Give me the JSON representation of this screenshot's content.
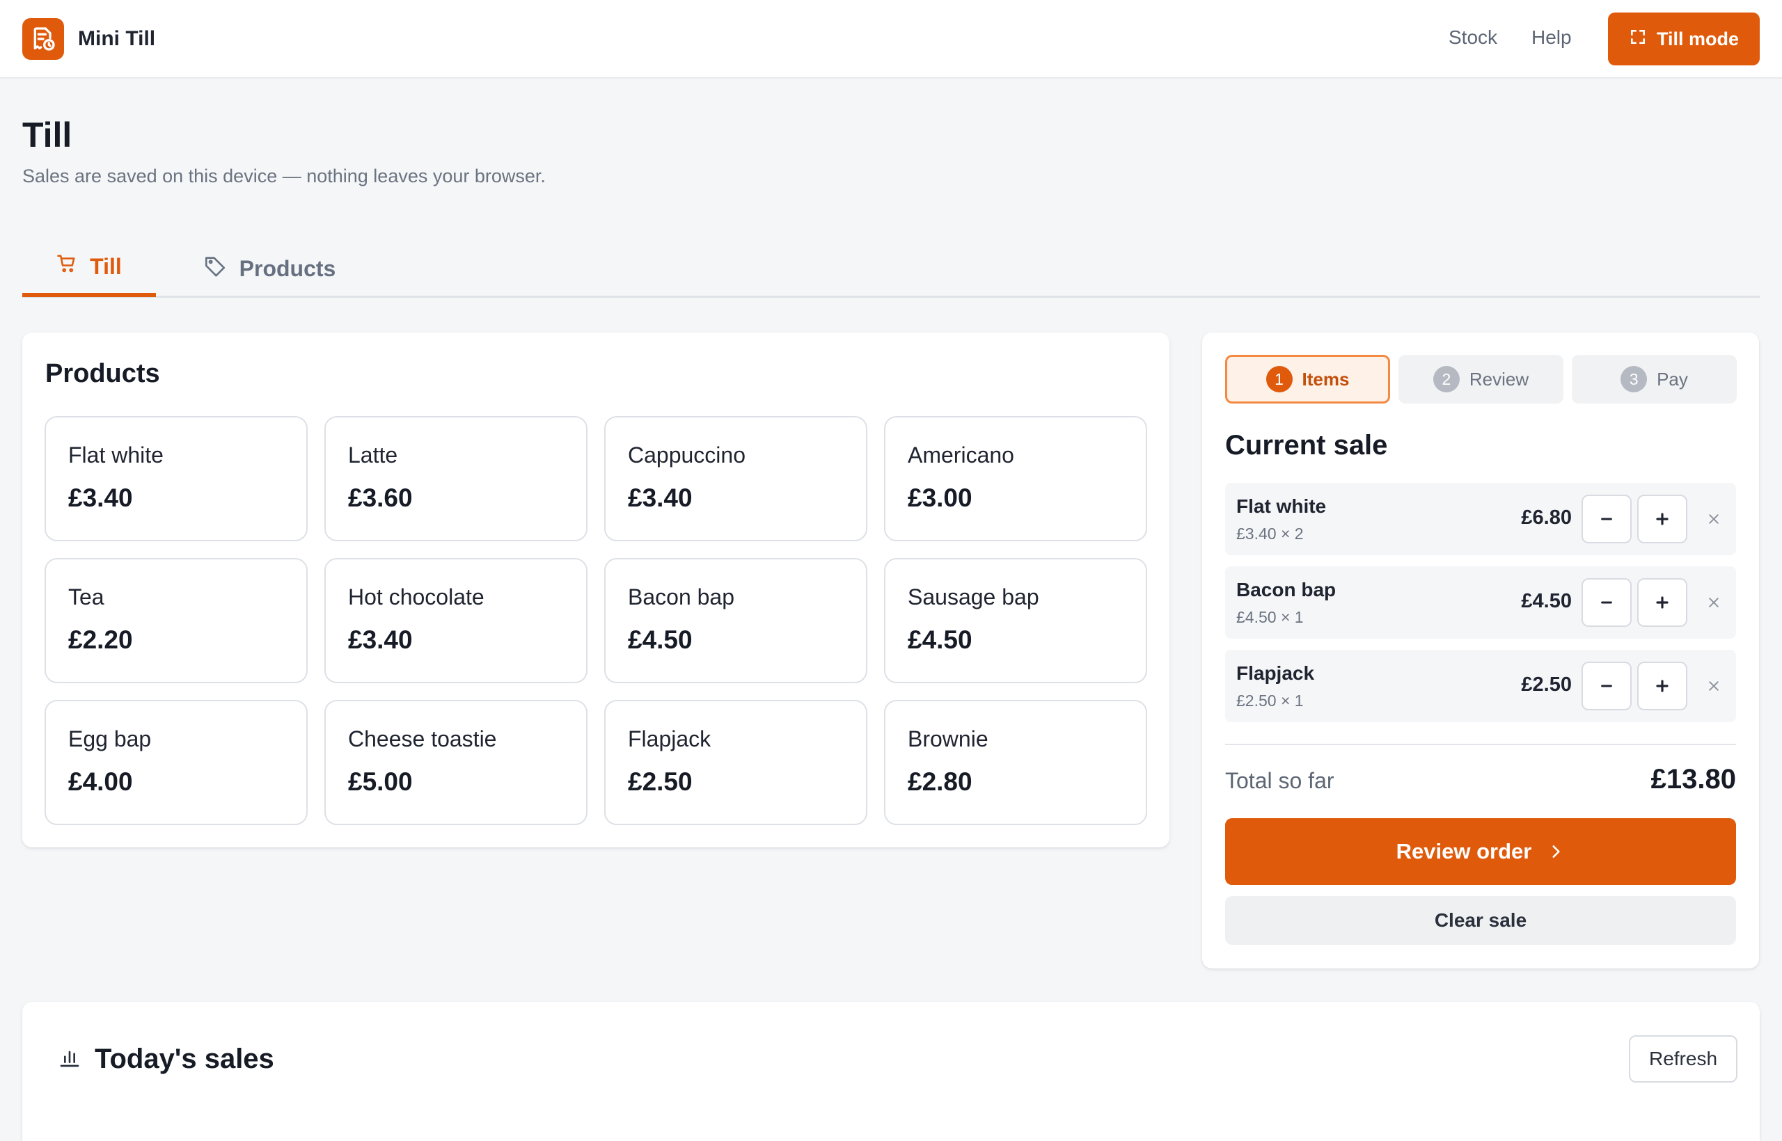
{
  "app": {
    "name": "Mini Till",
    "logo_icon": "receipt-icon",
    "accent_color": "#df5a0b"
  },
  "nav": {
    "links": [
      "Stock",
      "Help"
    ],
    "till_mode_label": "Till mode"
  },
  "page": {
    "title": "Till",
    "subtitle": "Sales are saved on this device — nothing leaves your browser."
  },
  "tabs": [
    {
      "label": "Till",
      "icon": "cart-icon",
      "active": true
    },
    {
      "label": "Products",
      "icon": "tag-icon",
      "active": false
    }
  ],
  "products": {
    "title": "Products",
    "items": [
      {
        "name": "Flat white",
        "price": "£3.40"
      },
      {
        "name": "Latte",
        "price": "£3.60"
      },
      {
        "name": "Cappuccino",
        "price": "£3.40"
      },
      {
        "name": "Americano",
        "price": "£3.00"
      },
      {
        "name": "Tea",
        "price": "£2.20"
      },
      {
        "name": "Hot chocolate",
        "price": "£3.40"
      },
      {
        "name": "Bacon bap",
        "price": "£4.50"
      },
      {
        "name": "Sausage bap",
        "price": "£4.50"
      },
      {
        "name": "Egg bap",
        "price": "£4.00"
      },
      {
        "name": "Cheese toastie",
        "price": "£5.00"
      },
      {
        "name": "Flapjack",
        "price": "£2.50"
      },
      {
        "name": "Brownie",
        "price": "£2.80"
      }
    ]
  },
  "sale": {
    "steps": [
      {
        "num": "1",
        "label": "Items",
        "active": true
      },
      {
        "num": "2",
        "label": "Review",
        "active": false
      },
      {
        "num": "3",
        "label": "Pay",
        "active": false
      }
    ],
    "title": "Current sale",
    "lines": [
      {
        "name": "Flat white",
        "detail": "£3.40 × 2",
        "total": "£6.80"
      },
      {
        "name": "Bacon bap",
        "detail": "£4.50 × 1",
        "total": "£4.50"
      },
      {
        "name": "Flapjack",
        "detail": "£2.50 × 1",
        "total": "£2.50"
      }
    ],
    "total_label": "Total so far",
    "total_value": "£13.80",
    "review_label": "Review order",
    "clear_label": "Clear sale"
  },
  "sales_today": {
    "title": "Today's sales",
    "icon": "bar-chart-icon",
    "refresh_label": "Refresh"
  }
}
